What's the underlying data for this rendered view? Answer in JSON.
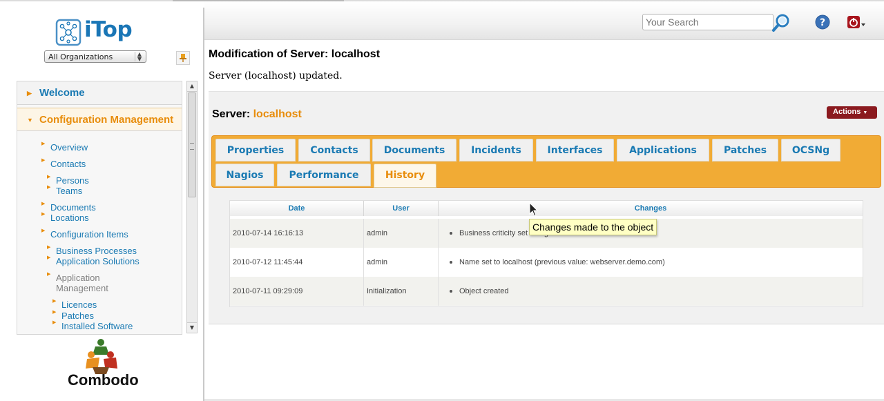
{
  "header": {
    "search_placeholder": "Your Search"
  },
  "sidebar": {
    "logo_text": "iTop",
    "org_select_value": "All Organizations",
    "accordion": {
      "welcome": "Welcome",
      "config": "Configuration Management"
    },
    "items": [
      "Overview",
      "Contacts",
      "Persons",
      "Teams",
      "Documents",
      "Locations",
      "Configuration Items",
      "Business Processes",
      "Application Solutions",
      "Application Management",
      "Licences",
      "Patches",
      "Installed Software"
    ],
    "footer_logo_text": "Combodo"
  },
  "main": {
    "page_title": "Modification of Server: localhost",
    "update_message": "Server (localhost) updated.",
    "object_label": "Server:",
    "object_name": "localhost",
    "actions_label": "Actions",
    "tabs": [
      "Properties",
      "Contacts",
      "Documents",
      "Incidents",
      "Interfaces",
      "Applications",
      "Patches",
      "OCSNg",
      "Nagios",
      "Performance",
      "History"
    ],
    "active_tab": "History",
    "history": {
      "columns": [
        "Date",
        "User",
        "Changes"
      ],
      "rows": [
        {
          "date": "2010-07-14 16:16:13",
          "user": "admin",
          "change": "Business criticity set to high"
        },
        {
          "date": "2010-07-12 11:45:44",
          "user": "admin",
          "change": "Name set to localhost (previous value: webserver.demo.com)"
        },
        {
          "date": "2010-07-11 09:29:09",
          "user": "Initialization",
          "change": "Object created"
        }
      ]
    },
    "tooltip": "Changes made to the object"
  },
  "colors": {
    "link_blue": "#1a7ab3",
    "accent_orange": "#e88d0c",
    "tabs_bar_orange": "#f1ab35",
    "actions_red": "#8b1a1f",
    "tooltip_yellow": "#ffffc4"
  },
  "icons": [
    "itop-logo-icon",
    "search-icon",
    "help-icon",
    "logoff-icon",
    "pin-icon",
    "combodo-logo-icon"
  ]
}
